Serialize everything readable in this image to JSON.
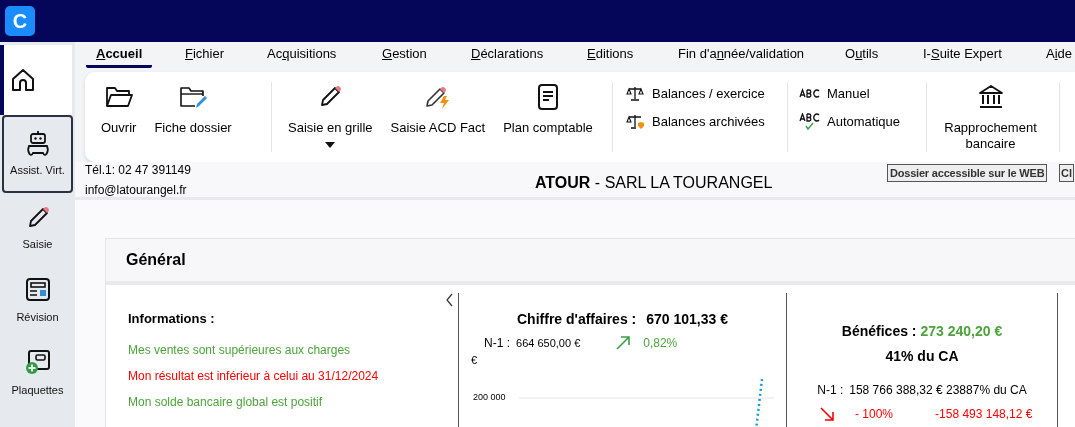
{
  "app": {
    "logo": "C"
  },
  "sidebar": {
    "items": [
      {
        "kind": "home",
        "selected": true
      },
      {
        "kind": "robot",
        "label": "Assist. Virt.",
        "selected": false
      },
      {
        "kind": "pencil",
        "label": "Saisie",
        "selected": false
      },
      {
        "kind": "review",
        "label": "Révision",
        "selected": false
      },
      {
        "kind": "plaquette",
        "label": "Plaquettes",
        "selected": false
      }
    ]
  },
  "menu": [
    {
      "key": "A",
      "after": "ccueil",
      "selected": true
    },
    {
      "key": "F",
      "after": "ichier",
      "selected": false
    },
    {
      "before": "Ac",
      "key": "q",
      "after": "uisitions",
      "selected": false
    },
    {
      "key": "G",
      "after": "estion",
      "selected": false
    },
    {
      "key": "D",
      "after": "éclarations",
      "selected": false
    },
    {
      "key": "E",
      "after": "ditions",
      "selected": false
    },
    {
      "before": "Fin d'a",
      "key": "n",
      "after": "née/validation",
      "selected": false
    },
    {
      "before": "O",
      "key": "u",
      "after": "tils",
      "selected": false
    },
    {
      "before": "I-",
      "key": "S",
      "after": "uite Expert",
      "selected": false
    },
    {
      "before": "A",
      "key": "i",
      "after": "de",
      "selected": false
    }
  ],
  "ribbon": {
    "groups": [
      [
        {
          "kind": "folder",
          "label": "Ouvrir"
        },
        {
          "kind": "folder-edit",
          "label": "Fiche dossier"
        }
      ],
      [
        {
          "kind": "pencil",
          "label": "Saisie en grille",
          "dropdown": true
        },
        {
          "kind": "pencil-bolt",
          "label": "Saisie ACD Fact"
        },
        {
          "kind": "document",
          "label": "Plan comptable"
        }
      ],
      [
        {
          "kind": "stack",
          "items": [
            {
              "label": "Balances / exercice"
            },
            {
              "label": "Balances archivées"
            }
          ]
        }
      ],
      [
        {
          "kind": "stack",
          "items": [
            {
              "label": "Manuel"
            },
            {
              "label": "Automatique"
            }
          ]
        }
      ],
      [
        {
          "kind": "bank",
          "label": "Rapprochement bancaire"
        }
      ]
    ]
  },
  "info_bar": {
    "phone": "Tél.1: 02 47 391149",
    "email": "info@latourangel.fr",
    "code": "ATOUR",
    "company": " - SARL LA TOURANGEL",
    "web_button": "Dossier accessible sur le WEB",
    "next_button": "Cl"
  },
  "general": {
    "title": "Général",
    "informations": {
      "title": "Informations :",
      "lines": [
        {
          "text": "Mes ventes sont supérieures aux charges",
          "color": "#4ca33a"
        },
        {
          "text": "Mon résultat est inférieur à celui au 31/12/2024",
          "color": "#ff0000"
        },
        {
          "text": "Mon solde bancaire global est positif",
          "color": "#4ca33a"
        }
      ]
    },
    "chiffre_affaires": {
      "label": "Chiffre d'affaires :",
      "value": "670 101,33 €",
      "previous_label": "N-1 :",
      "previous_value": "664 650,00 €",
      "change": "0,82%",
      "unit": "€",
      "tick": "200 000"
    },
    "benefices": {
      "label": "Bénéfices :",
      "value": "273 240,20 €",
      "ratio": "41% du CA",
      "previous_label": "N-1 :",
      "previous_value": "158 766 388,32 € 23887% du CA",
      "change": "- 100%",
      "difference": "-158 493 148,12 €"
    }
  }
}
